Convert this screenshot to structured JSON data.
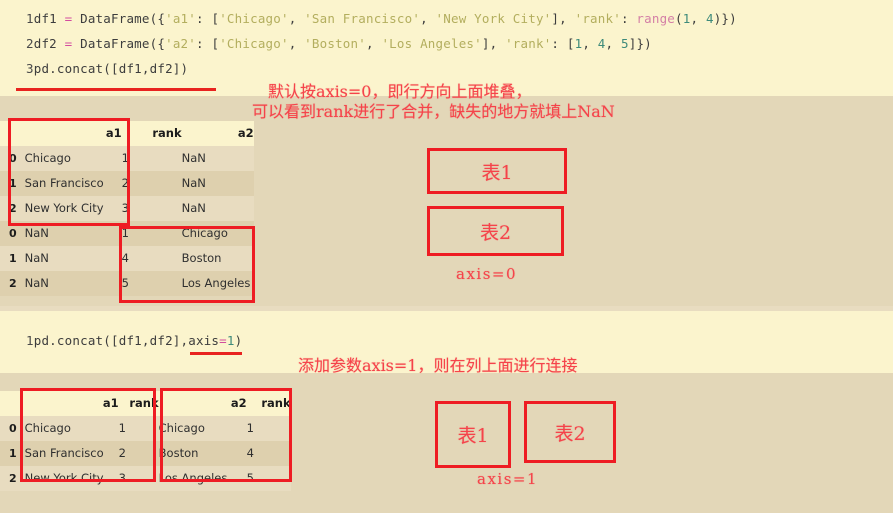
{
  "section1": {
    "code_lines": [
      {
        "num": "1",
        "tokens": [
          {
            "t": "df1 ",
            "c": "plain"
          },
          {
            "t": "=",
            "c": "op"
          },
          {
            "t": " DataFrame({",
            "c": "plain"
          },
          {
            "t": "'a1'",
            "c": "str"
          },
          {
            "t": ": [",
            "c": "plain"
          },
          {
            "t": "'Chicago'",
            "c": "str"
          },
          {
            "t": ", ",
            "c": "plain"
          },
          {
            "t": "'San Francisco'",
            "c": "str"
          },
          {
            "t": ", ",
            "c": "plain"
          },
          {
            "t": "'New York City'",
            "c": "str"
          },
          {
            "t": "], ",
            "c": "plain"
          },
          {
            "t": "'rank'",
            "c": "str"
          },
          {
            "t": ": ",
            "c": "plain"
          },
          {
            "t": "range",
            "c": "fn"
          },
          {
            "t": "(",
            "c": "plain"
          },
          {
            "t": "1",
            "c": "num"
          },
          {
            "t": ", ",
            "c": "plain"
          },
          {
            "t": "4",
            "c": "num"
          },
          {
            "t": ")})",
            "c": "plain"
          }
        ]
      },
      {
        "num": "2",
        "tokens": [
          {
            "t": "df2 ",
            "c": "plain"
          },
          {
            "t": "=",
            "c": "op"
          },
          {
            "t": " DataFrame({",
            "c": "plain"
          },
          {
            "t": "'a2'",
            "c": "str"
          },
          {
            "t": ": [",
            "c": "plain"
          },
          {
            "t": "'Chicago'",
            "c": "str"
          },
          {
            "t": ", ",
            "c": "plain"
          },
          {
            "t": "'Boston'",
            "c": "str"
          },
          {
            "t": ", ",
            "c": "plain"
          },
          {
            "t": "'Los Angeles'",
            "c": "str"
          },
          {
            "t": "], ",
            "c": "plain"
          },
          {
            "t": "'rank'",
            "c": "str"
          },
          {
            "t": ": [",
            "c": "plain"
          },
          {
            "t": "1",
            "c": "num"
          },
          {
            "t": ", ",
            "c": "plain"
          },
          {
            "t": "4",
            "c": "num"
          },
          {
            "t": ", ",
            "c": "plain"
          },
          {
            "t": "5",
            "c": "num"
          },
          {
            "t": "]})",
            "c": "plain"
          }
        ]
      },
      {
        "num": "3",
        "tokens": [
          {
            "t": "pd.concat([df1,df2])",
            "c": "plain"
          }
        ]
      }
    ],
    "annotation_line1": "默认按axis=0，即行方向上面堆叠，",
    "annotation_line2": "可以看到rank进行了合并，缺失的地方就填上NaN",
    "table": {
      "columns": [
        "",
        "a1",
        "rank",
        "a2"
      ],
      "rows": [
        {
          "index": "0",
          "a1": "Chicago",
          "rank": "1",
          "a2": "NaN"
        },
        {
          "index": "1",
          "a1": "San Francisco",
          "rank": "2",
          "a2": "NaN"
        },
        {
          "index": "2",
          "a1": "New York City",
          "rank": "3",
          "a2": "NaN"
        },
        {
          "index": "0",
          "a1": "NaN",
          "rank": "1",
          "a2": "Chicago"
        },
        {
          "index": "1",
          "a1": "NaN",
          "rank": "4",
          "a2": "Boston"
        },
        {
          "index": "2",
          "a1": "NaN",
          "rank": "5",
          "a2": "Los Angeles"
        }
      ]
    },
    "callouts": {
      "box1_label": "表1",
      "box2_label": "表2",
      "axis_label": "axis=0"
    }
  },
  "section2": {
    "code_lines": [
      {
        "num": "1",
        "tokens": [
          {
            "t": "pd.concat([df1,df2],axis",
            "c": "plain"
          },
          {
            "t": "=",
            "c": "op"
          },
          {
            "t": "1",
            "c": "num"
          },
          {
            "t": ")",
            "c": "plain"
          }
        ]
      }
    ],
    "annotation_line1": "添加参数axis=1，则在列上面进行连接",
    "table": {
      "columns": [
        "",
        "a1",
        "rank",
        "a2",
        "rank"
      ],
      "rows": [
        {
          "index": "0",
          "a1": "Chicago",
          "rank1": "1",
          "a2": "Chicago",
          "rank2": "1"
        },
        {
          "index": "1",
          "a1": "San Francisco",
          "rank1": "2",
          "a2": "Boston",
          "rank2": "4"
        },
        {
          "index": "2",
          "a1": "New York City",
          "rank1": "3",
          "a2": "Los Angeles",
          "rank2": "5"
        }
      ]
    },
    "callouts": {
      "box1_label": "表1",
      "box2_label": "表2",
      "axis_label": "axis=1"
    }
  },
  "theme": {
    "code_bg": "#fbf4cd",
    "output_bg": "#e3d7b8",
    "page_bg": "#e8dcc0",
    "annotation_color": "#f5434a",
    "box_border": "#ee1c23",
    "string_color": "#b3ae5e",
    "operator_color": "#d34c9e"
  }
}
